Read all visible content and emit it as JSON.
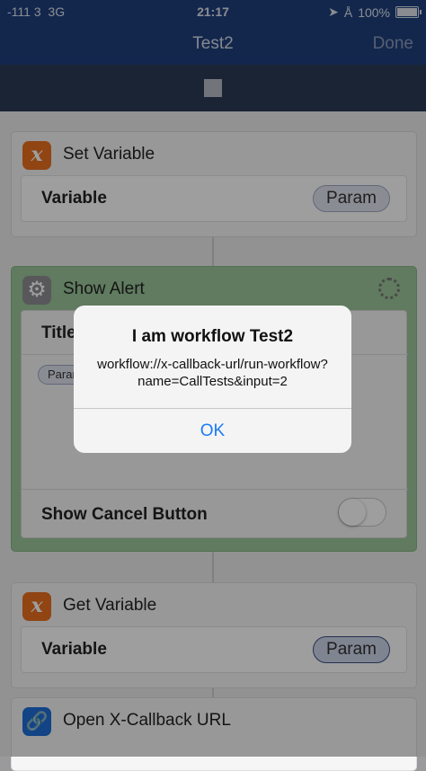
{
  "status": {
    "signal": "-111 3",
    "network": "3G",
    "time": "21:17",
    "battery": "100%"
  },
  "nav": {
    "title": "Test2",
    "done_label": "Done"
  },
  "actions": {
    "set_variable": {
      "title": "Set Variable",
      "field_label": "Variable",
      "value": "Param",
      "icon": "x-variable-icon",
      "color": "#e8701f"
    },
    "show_alert": {
      "title": "Show Alert",
      "title_field_label": "Title",
      "param_token": "Param",
      "cancel_label": "Show Cancel Button",
      "icon": "gear-icon",
      "color": "#8e8e93"
    },
    "get_variable": {
      "title": "Get Variable",
      "field_label": "Variable",
      "value": "Param",
      "icon": "x-variable-icon",
      "color": "#e8701f"
    },
    "open_xcallback": {
      "title": "Open X-Callback URL",
      "icon": "link-icon",
      "color": "#1e6fd9"
    }
  },
  "alert": {
    "title": "I am workflow Test2",
    "message": "workflow://x-callback-url/run-workflow?name=CallTests&input=2",
    "ok_label": "OK"
  }
}
